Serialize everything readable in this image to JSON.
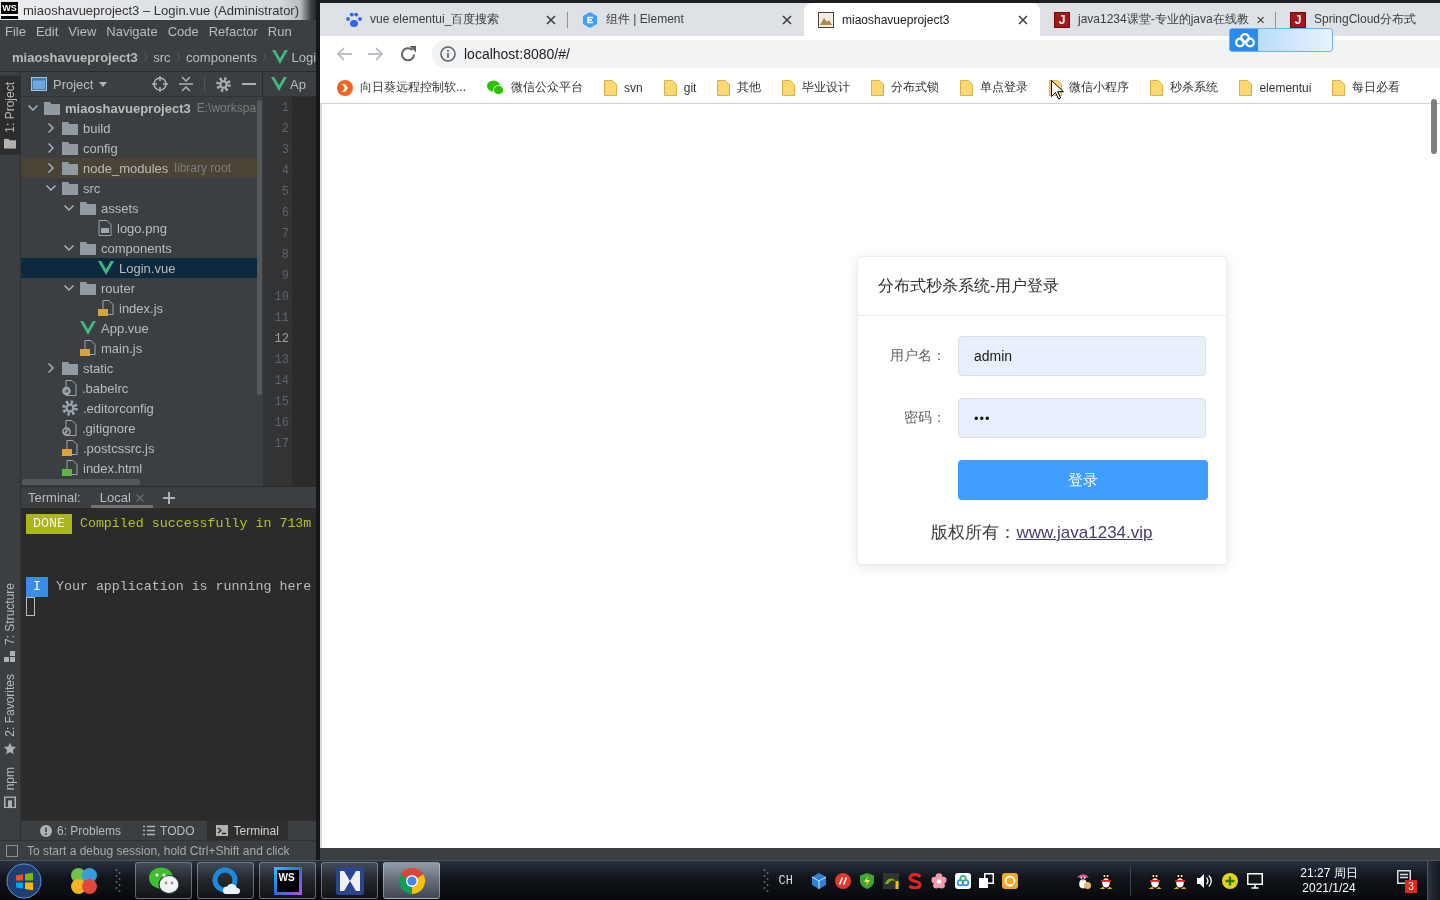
{
  "ide": {
    "logo": "WS",
    "title": "miaoshavueproject3 – Login.vue (Administrator)",
    "menu": [
      "File",
      "Edit",
      "View",
      "Navigate",
      "Code",
      "Refactor",
      "Run"
    ],
    "breadcrumb": [
      {
        "label": "miaoshavueproject3",
        "kind": "project"
      },
      {
        "label": "src",
        "kind": "folder"
      },
      {
        "label": "components",
        "kind": "folder"
      },
      {
        "label": "Logi",
        "kind": "vue"
      }
    ],
    "tool_strip": {
      "top": [
        {
          "label": "1: Project",
          "kind": "project",
          "selected": true
        }
      ],
      "bottom": [
        {
          "label": "7: Structure",
          "kind": "structure",
          "selected": false
        },
        {
          "label": "2: Favorites",
          "kind": "favorites",
          "selected": false
        },
        {
          "label": "npm",
          "kind": "npm",
          "selected": false
        }
      ]
    },
    "project_panel": {
      "title": "Project",
      "tree": [
        {
          "label": "miaoshavueproject3",
          "note": "E:\\workspa",
          "kind": "project",
          "expanded": true,
          "selected": false,
          "children": [
            {
              "label": "build",
              "kind": "folder",
              "expanded": false,
              "selected": false
            },
            {
              "label": "config",
              "kind": "folder",
              "expanded": false,
              "selected": false
            },
            {
              "label": "node_modules",
              "note": "library root",
              "kind": "library",
              "expanded": false,
              "selected": false
            },
            {
              "label": "src",
              "kind": "folder",
              "expanded": true,
              "selected": false,
              "children": [
                {
                  "label": "assets",
                  "kind": "folder",
                  "expanded": true,
                  "selected": false,
                  "children": [
                    {
                      "label": "logo.png",
                      "kind": "image",
                      "selected": false
                    }
                  ]
                },
                {
                  "label": "components",
                  "kind": "folder",
                  "expanded": true,
                  "selected": false,
                  "children": [
                    {
                      "label": "Login.vue",
                      "kind": "vue",
                      "selected": true
                    }
                  ]
                },
                {
                  "label": "router",
                  "kind": "folder",
                  "expanded": true,
                  "selected": false,
                  "children": [
                    {
                      "label": "index.js",
                      "kind": "js",
                      "selected": false
                    }
                  ]
                },
                {
                  "label": "App.vue",
                  "kind": "vue",
                  "selected": false
                },
                {
                  "label": "main.js",
                  "kind": "js",
                  "selected": false
                }
              ]
            },
            {
              "label": "static",
              "kind": "folder",
              "expanded": false,
              "selected": false
            },
            {
              "label": ".babelrc",
              "kind": "babel",
              "selected": false
            },
            {
              "label": ".editorconfig",
              "kind": "settings",
              "selected": false
            },
            {
              "label": ".gitignore",
              "kind": "ignore",
              "selected": false
            },
            {
              "label": ".postcssrc.js",
              "kind": "js",
              "selected": false
            },
            {
              "label": "index.html",
              "kind": "html",
              "selected": false
            }
          ]
        }
      ]
    },
    "editor_tab": {
      "label": "Ap",
      "kind": "vue"
    },
    "line_numbers": [
      {
        "label": "1",
        "current": false
      },
      {
        "label": "2",
        "current": false
      },
      {
        "label": "3",
        "current": false
      },
      {
        "label": "4",
        "current": false
      },
      {
        "label": "5",
        "current": false
      },
      {
        "label": "6",
        "current": false
      },
      {
        "label": "7",
        "current": false
      },
      {
        "label": "8",
        "current": false
      },
      {
        "label": "9",
        "current": false
      },
      {
        "label": "10",
        "current": false
      },
      {
        "label": "11",
        "current": false
      },
      {
        "label": "12",
        "current": true
      },
      {
        "label": "13",
        "current": false
      },
      {
        "label": "14",
        "current": false
      },
      {
        "label": "15",
        "current": false
      },
      {
        "label": "16",
        "current": false
      },
      {
        "label": "17",
        "current": false
      }
    ],
    "terminal": {
      "title": "Terminal:",
      "tabs": [
        {
          "label": "Local",
          "selected": true
        }
      ],
      "lines": [
        {
          "kind": "done",
          "badge": "DONE",
          "text": "Compiled successfully in 713m"
        },
        {
          "kind": "info",
          "badge": "I",
          "text": "Your application is running here"
        }
      ]
    },
    "tool_tabs": [
      {
        "label": "6: Problems",
        "kind": "problems",
        "selected": false
      },
      {
        "label": "TODO",
        "kind": "todo",
        "selected": false
      },
      {
        "label": "Terminal",
        "kind": "terminal",
        "selected": true
      }
    ],
    "status_bar": "To start a debug session, hold Ctrl+Shift and click"
  },
  "browser": {
    "tabs": [
      {
        "title": "vue elementui_百度搜索",
        "kind": "paw",
        "selected": false,
        "closable": true
      },
      {
        "title": "组件 | Element",
        "kind": "hexagon",
        "selected": false,
        "closable": true
      },
      {
        "title": "miaoshavueproject3",
        "kind": "image",
        "selected": true,
        "closable": true
      },
      {
        "title": "java1234课堂-专业的java在线教",
        "kind": "letter",
        "icon_text": "J",
        "selected": false,
        "closable": true
      },
      {
        "title": "SpringCloud分布式",
        "kind": "letter",
        "icon_text": "J",
        "selected": false,
        "closable": false
      }
    ],
    "address": "localhost:8080/#/",
    "bookmarks": [
      {
        "label": "向日葵远程控制软...",
        "kind": "sun"
      },
      {
        "label": "微信公众平台",
        "kind": "chat"
      },
      {
        "label": "svn",
        "kind": "folder"
      },
      {
        "label": "git",
        "kind": "folder"
      },
      {
        "label": "其他",
        "kind": "folder"
      },
      {
        "label": "毕业设计",
        "kind": "folder"
      },
      {
        "label": "分布式锁",
        "kind": "folder"
      },
      {
        "label": "单点登录",
        "kind": "folder"
      },
      {
        "label": "微信小程序",
        "kind": "folder"
      },
      {
        "label": "秒杀系统",
        "kind": "folder"
      },
      {
        "label": "elementui",
        "kind": "folder"
      },
      {
        "label": "每日必看",
        "kind": "folder"
      }
    ]
  },
  "page": {
    "login": {
      "title": "分布式秒杀系统-用户登录",
      "fields": [
        {
          "label": "用户名：",
          "value": "admin",
          "kind": "text"
        },
        {
          "label": "密码：",
          "value": "•••",
          "kind": "password"
        }
      ],
      "button": "登录",
      "copyright": {
        "text": "版权所有：",
        "link": "www.java1234.vip"
      }
    }
  },
  "taskbar": {
    "quick_launch": [
      {
        "kind": "circles"
      }
    ],
    "apps": [
      {
        "kind": "chat",
        "running": true,
        "selected": false
      },
      {
        "kind": "ring",
        "running": true,
        "selected": false
      },
      {
        "kind": "logo",
        "text": "WS",
        "running": true,
        "selected": false
      },
      {
        "kind": "hourglass",
        "running": true,
        "selected": false
      },
      {
        "kind": "browser",
        "running": true,
        "selected": true
      }
    ],
    "language": "CH",
    "tray": [
      {
        "kind": "cube"
      },
      {
        "kind": "disc"
      },
      {
        "kind": "shield"
      },
      {
        "kind": "chip"
      },
      {
        "kind": "swirl"
      },
      {
        "kind": "flower"
      },
      {
        "kind": "cloud"
      },
      {
        "kind": "copy"
      },
      {
        "kind": "sun"
      }
    ],
    "pinned_tray": [
      {
        "kind": "penguin-hat"
      },
      {
        "kind": "penguin"
      }
    ],
    "system_tray": [
      {
        "kind": "penguin"
      },
      {
        "kind": "penguin"
      },
      {
        "kind": "speaker"
      },
      {
        "kind": "plus"
      },
      {
        "kind": "monitor"
      }
    ],
    "clock": {
      "time": "21:27 周日",
      "date": "2021/1/24"
    },
    "notification_count": "3"
  }
}
